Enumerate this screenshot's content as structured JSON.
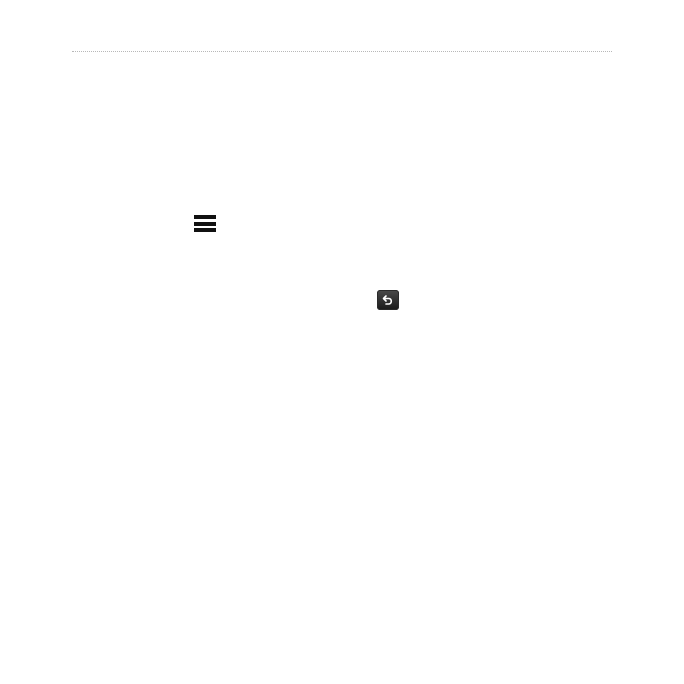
{
  "page": {
    "background": "#ffffff"
  },
  "icons": {
    "menu": "menu-icon",
    "back": "back-icon"
  },
  "colors": {
    "rule": "#b8b8b8",
    "menu_icon": "#111111",
    "back_button": "#2a2a2a"
  }
}
